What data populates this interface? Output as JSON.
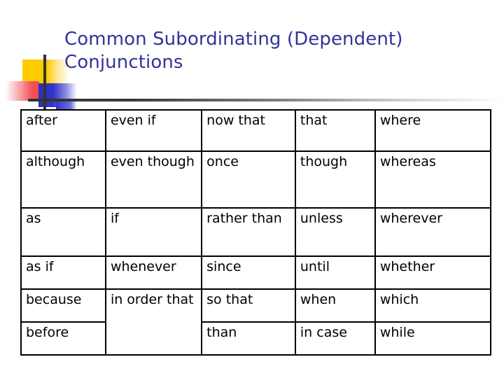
{
  "slide": {
    "title": "Common Subordinating (Dependent) Conjunctions",
    "title_color": "#333399",
    "background_color": "#FFFFFF"
  },
  "decoration": {
    "yellow_color": "#FFCC00",
    "blue_color": "#3333CC",
    "red_color": "#F14B54",
    "rule_color": "#333333"
  },
  "table": {
    "columns": 5,
    "rows": 6,
    "border_color": "#000000",
    "cells": [
      [
        "after",
        "even if",
        "now that",
        "that",
        "where"
      ],
      [
        "although",
        "even though",
        "once",
        "though",
        "whereas"
      ],
      [
        "as",
        "if",
        "rather than",
        "unless",
        "wherever"
      ],
      [
        "as if",
        "whenever",
        "since",
        "until",
        "whether"
      ],
      [
        "because",
        "in order that",
        "so that",
        "when",
        "which"
      ],
      [
        "before",
        "",
        "than",
        "in case",
        "while"
      ]
    ]
  }
}
